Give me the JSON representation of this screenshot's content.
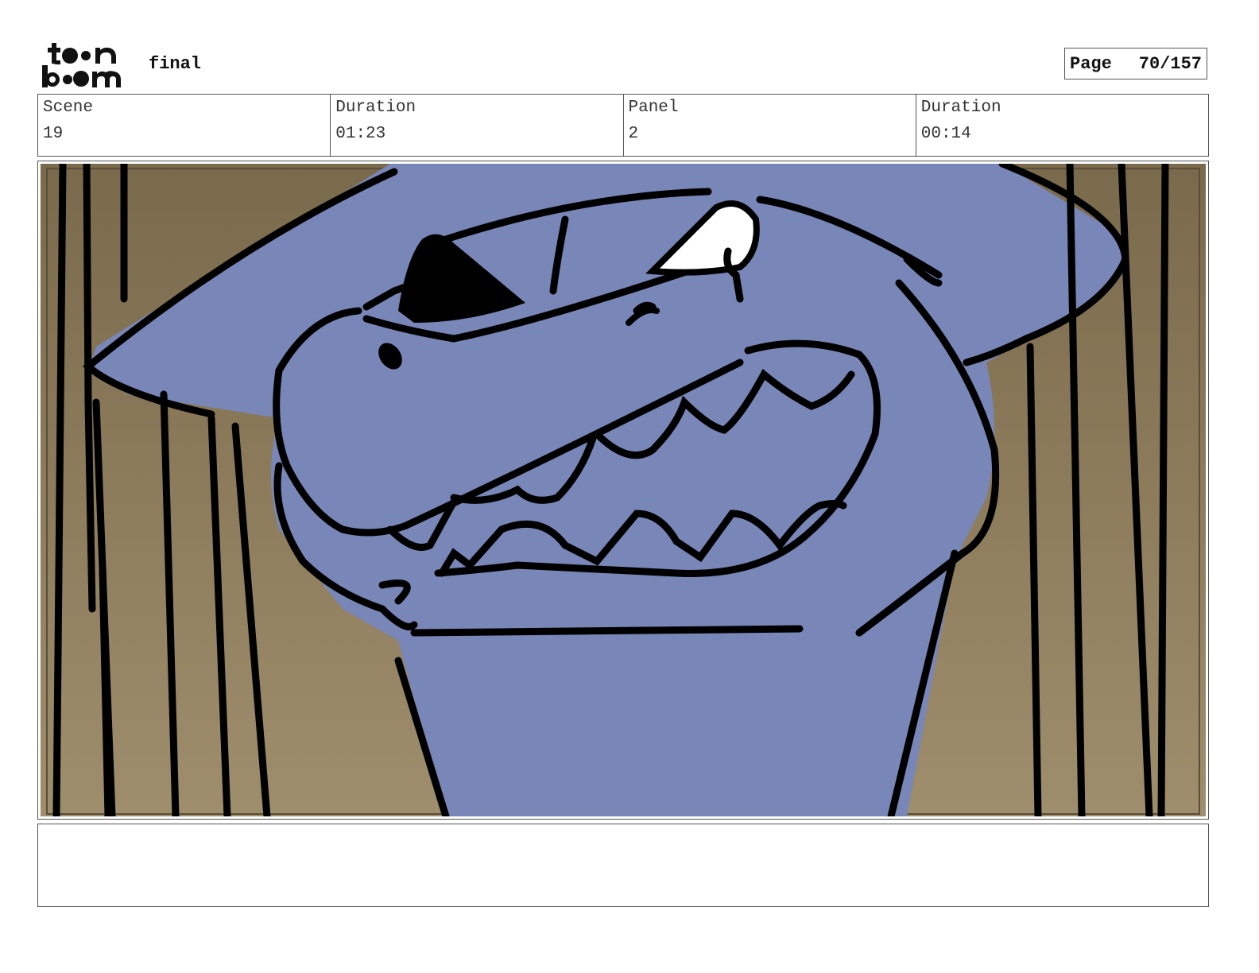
{
  "header": {
    "logo_text": "toon boom",
    "project_name": "final",
    "page_label": "Page",
    "page_value": "70/157"
  },
  "info": {
    "scene_label": "Scene",
    "scene_value": "19",
    "scene_duration_label": "Duration",
    "scene_duration_value": "01:23",
    "panel_label": "Panel",
    "panel_value": "2",
    "panel_duration_label": "Duration",
    "panel_duration_value": "00:14"
  },
  "notes": {
    "text": ""
  },
  "colors": {
    "creature": "#7986b8",
    "background": "#9a8a6a",
    "ink": "#000000"
  }
}
